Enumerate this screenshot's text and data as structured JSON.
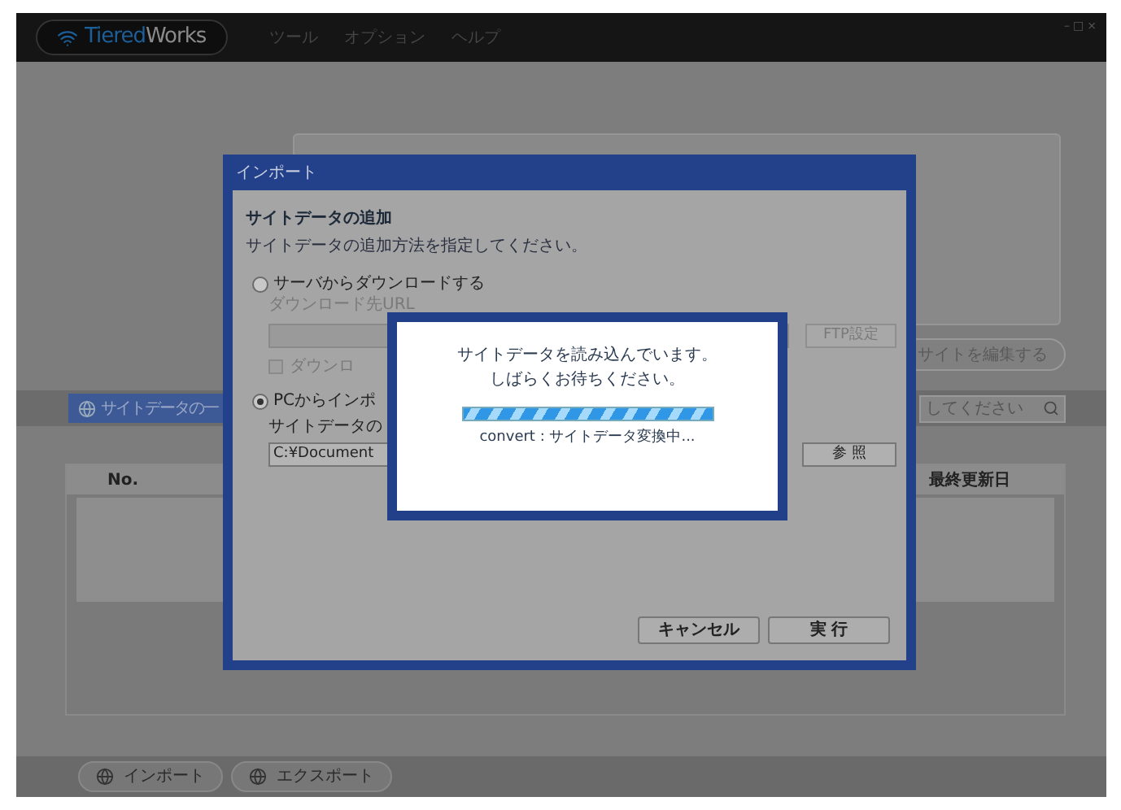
{
  "window": {
    "logo": {
      "part1": "Tiered",
      "part2": "Works"
    },
    "menu": [
      "ツール",
      "オプション",
      "ヘルプ"
    ],
    "controls": [
      "–",
      "□",
      "×"
    ]
  },
  "main": {
    "edit_button": "サイトを編集する",
    "list_tab": "サイトデータの一",
    "search": {
      "value": "してください"
    },
    "table": {
      "columns": [
        "No.",
        "最終更新日"
      ]
    },
    "bottom_buttons": [
      "インポート",
      "エクスポート"
    ]
  },
  "import_dialog": {
    "title": "インポート",
    "heading": "サイトデータの追加",
    "description": "サイトデータの追加方法を指定してください。",
    "options": [
      {
        "label": "サーバからダウンロードする",
        "selected": false
      },
      {
        "label": "PCからインポ",
        "selected": true
      }
    ],
    "url_label": "ダウンロード先URL",
    "ftp_button": "FTP設定",
    "download_checkbox": {
      "label": "ダウンロ",
      "checked": false
    },
    "file_label": "サイトデータの",
    "file_path": "C:¥Document",
    "browse_button": "参 照",
    "buttons": [
      "キャンセル",
      "実 行"
    ]
  },
  "progress_dialog": {
    "message": [
      "サイトデータを読み込んでいます。",
      "しばらくお待ちください。"
    ],
    "progress": {
      "level": 1
    },
    "status": "convert : サイトデータ変換中..."
  }
}
